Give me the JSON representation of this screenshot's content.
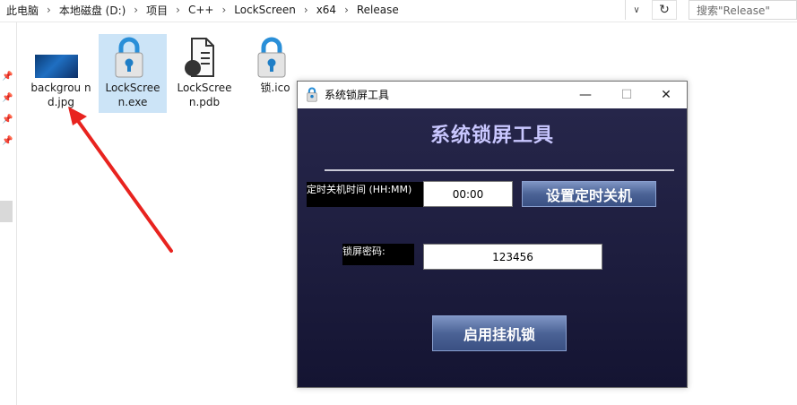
{
  "address_bar": {
    "breadcrumbs": [
      "此电脑",
      "本地磁盘 (D:)",
      "项目",
      "C++",
      "LockScreen",
      "x64",
      "Release"
    ],
    "search_placeholder": "搜索\"Release\""
  },
  "files": [
    {
      "name": "backgrou nd.jpg",
      "icon": "image-file-icon",
      "selected": false
    },
    {
      "name": "LockScree n.exe",
      "icon": "lock-app-icon",
      "selected": true
    },
    {
      "name": "LockScree n.pdb",
      "icon": "pdb-file-icon",
      "selected": false
    },
    {
      "name": "锁.ico",
      "icon": "lock-app-icon",
      "selected": false
    }
  ],
  "app_window": {
    "title": "系统锁屏工具",
    "heading": "系统锁屏工具",
    "shutdown_time_label": "定时关机时间 (HH:MM)",
    "shutdown_time_value": "00:00",
    "set_shutdown_button": "设置定时关机",
    "password_label": "锁屏密码:",
    "password_value": "123456",
    "enable_lock_button": "启用挂机锁",
    "controls": {
      "minimize": "—",
      "maximize": "☐",
      "close": "✕"
    }
  },
  "colors": {
    "annotation_arrow": "#e8231f",
    "window_bg": "#1d1d3e",
    "heading_text": "#c9c7ff",
    "button": "#4b6396",
    "selection": "#cce4f7"
  }
}
